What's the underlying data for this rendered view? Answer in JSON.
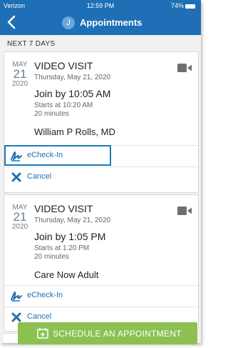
{
  "status_bar": {
    "carrier": "Verizon",
    "time": "12:59 PM",
    "battery": "74%"
  },
  "header": {
    "title": "Appointments",
    "avatar_initial": "J"
  },
  "section": {
    "label": "NEXT 7 DAYS"
  },
  "appointments": [
    {
      "month": "MAY",
      "day": "21",
      "year": "2020",
      "type": "VIDEO VISIT",
      "date_long": "Thursday, May 21, 2020",
      "join_text": "Join by 10:05 AM",
      "starts_text": "Starts at 10:20 AM",
      "duration": "20 minutes",
      "provider": "William P Rolls, MD",
      "echeckin_label": "eCheck-In",
      "cancel_label": "Cancel"
    },
    {
      "month": "MAY",
      "day": "21",
      "year": "2020",
      "type": "VIDEO VISIT",
      "date_long": "Thursday, May 21, 2020",
      "join_text": "Join by 1:05 PM",
      "starts_text": "Starts at 1:20 PM",
      "duration": "20 minutes",
      "provider": "Care Now Adult",
      "echeckin_label": "eCheck-In",
      "cancel_label": "Cancel"
    }
  ],
  "cta": {
    "label": "SCHEDULE AN APPOINTMENT"
  },
  "colors": {
    "header": "#1e6fb5",
    "accent": "#1e6fb5",
    "cta": "#8cc152",
    "cancel_x": "#1e6fb5"
  }
}
